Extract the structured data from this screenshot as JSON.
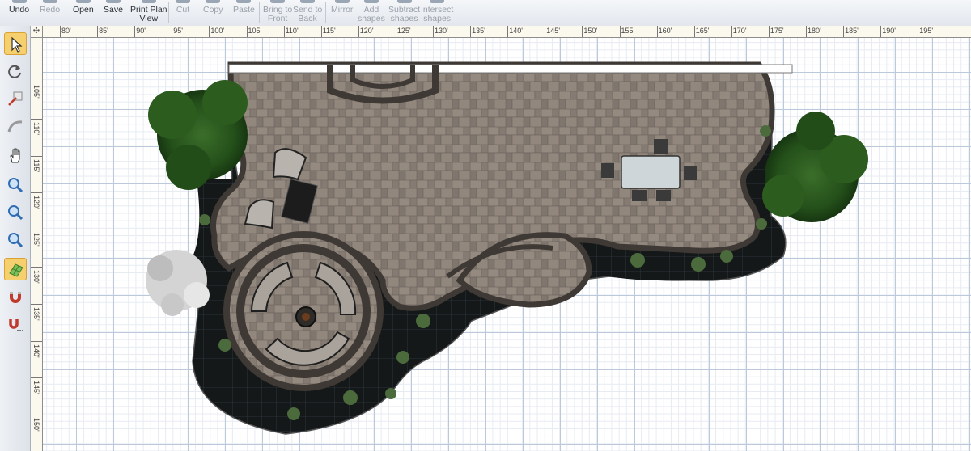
{
  "toolbar": {
    "undo": "Undo",
    "redo": "Redo",
    "open": "Open",
    "save": "Save",
    "print_plan_view_1": "Print Plan",
    "print_plan_view_2": "View",
    "cut": "Cut",
    "copy": "Copy",
    "paste": "Paste",
    "bring_to_front_1": "Bring to",
    "bring_to_front_2": "Front",
    "send_to_back_1": "Send to",
    "send_to_back_2": "Back",
    "mirror": "Mirror",
    "add_shapes_1": "Add",
    "add_shapes_2": "shapes",
    "subtract_shapes_1": "Subtract",
    "subtract_shapes_2": "shapes",
    "intersect_shapes_1": "Intersect",
    "intersect_shapes_2": "shapes"
  },
  "palette": {
    "tools": [
      "select-tool-icon",
      "rotate-tool-icon",
      "resize-tool-icon",
      "arc-tool-icon",
      "pan-hand-icon",
      "zoom-in-icon",
      "zoom-out-icon",
      "zoom-fit-icon",
      "grid-snap-icon",
      "magnet-snap-icon",
      "magnet-options-icon"
    ],
    "active_tool": "grid-snap-icon"
  },
  "ruler": {
    "corner": "✣",
    "top_labels": [
      "80'",
      "85'",
      "90'",
      "95'",
      "100'",
      "105'",
      "110'",
      "115'",
      "120'",
      "125'",
      "130'",
      "135'",
      "140'",
      "145'",
      "150'",
      "155'",
      "160'",
      "165'",
      "170'",
      "175'",
      "180'",
      "185'",
      "190'",
      "195'"
    ],
    "left_labels": [
      "105'",
      "110'",
      "115'",
      "120'",
      "125'",
      "130'",
      "135'",
      "140'",
      "145'",
      "150'",
      "155'"
    ]
  },
  "colors": {
    "paver": "#8b8178",
    "border": "#4a4440",
    "bed": "#171a1a",
    "accent_active": "#f6cf6e",
    "grid_major": "#bcc9da"
  }
}
